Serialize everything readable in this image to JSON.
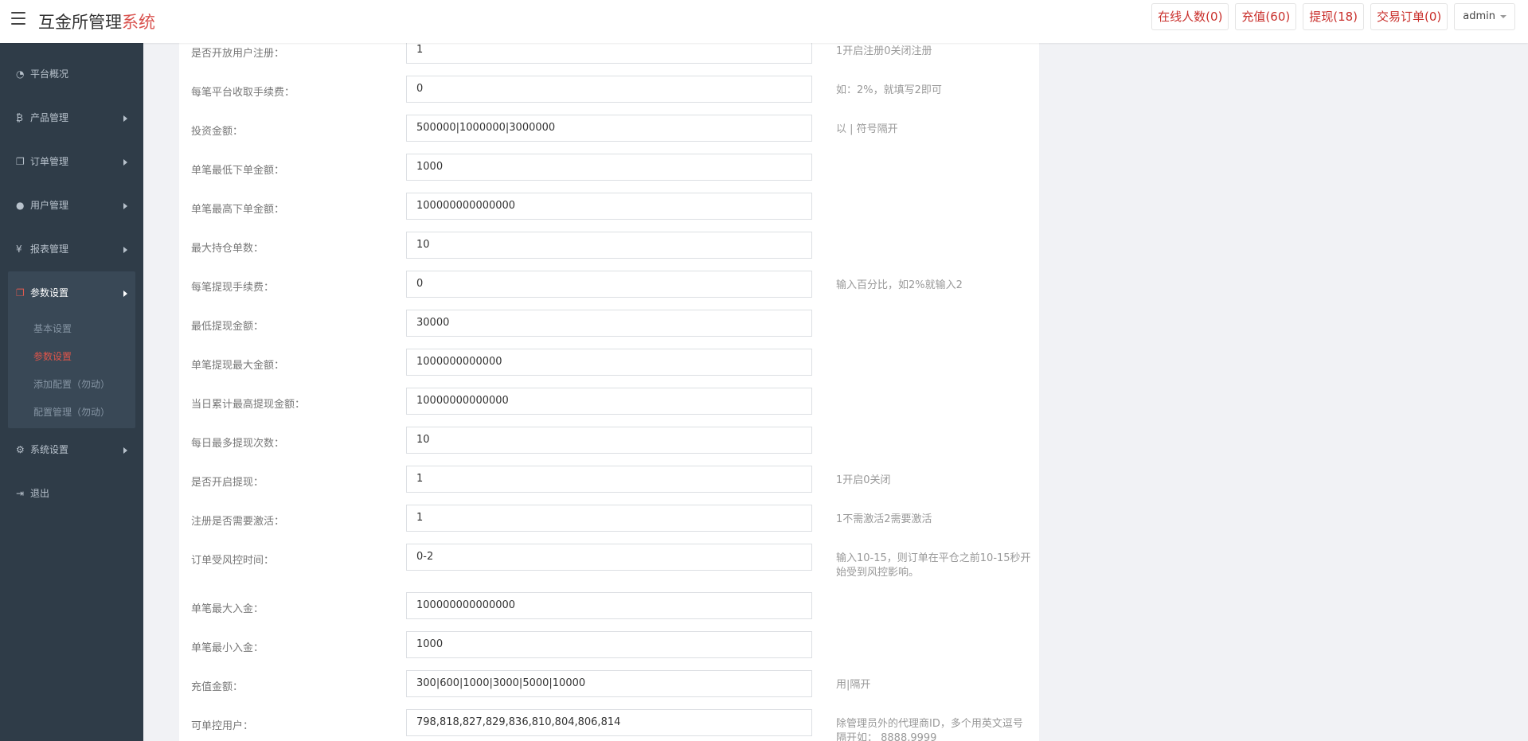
{
  "header": {
    "brand_main": "互金所管理",
    "brand_accent": "系统",
    "online_btn": "在线人数(0)",
    "recharge_btn": "充值(60)",
    "withdraw_btn": "提现(18)",
    "orders_btn": "交易订单(0)",
    "user": "admin"
  },
  "sidebar": {
    "overview": "平台概况",
    "products": "产品管理",
    "orders": "订单管理",
    "users": "用户管理",
    "reports": "报表管理",
    "params": "参数设置",
    "sub_basic": "基本设置",
    "sub_params": "参数设置",
    "sub_add": "添加配置（勿动）",
    "sub_manage": "配置管理（勿动）",
    "system": "系统设置",
    "logout": "退出"
  },
  "form": [
    {
      "label": "是否开放用户注册：",
      "value": "1",
      "hint": "1开启注册0关闭注册"
    },
    {
      "label": "每笔平台收取手续费：",
      "value": "0",
      "hint": "如：2%，就填写2即可"
    },
    {
      "label": "投资金额：",
      "value": "500000|1000000|3000000",
      "hint": "以 | 符号隔开"
    },
    {
      "label": "单笔最低下单金额：",
      "value": "1000",
      "hint": ""
    },
    {
      "label": "单笔最高下单金额：",
      "value": "100000000000000",
      "hint": ""
    },
    {
      "label": "最大持仓单数：",
      "value": "10",
      "hint": ""
    },
    {
      "label": "每笔提现手续费：",
      "value": "0",
      "hint": "输入百分比，如2%就输入2"
    },
    {
      "label": "最低提现金额：",
      "value": "30000",
      "hint": ""
    },
    {
      "label": "单笔提现最大金额：",
      "value": "1000000000000",
      "hint": ""
    },
    {
      "label": "当日累计最高提现金额：",
      "value": "10000000000000",
      "hint": ""
    },
    {
      "label": "每日最多提现次数：",
      "value": "10",
      "hint": ""
    },
    {
      "label": "是否开启提现：",
      "value": "1",
      "hint": "1开启0关闭"
    },
    {
      "label": "注册是否需要激活：",
      "value": "1",
      "hint": "1不需激活2需要激活"
    },
    {
      "label": "订单受风控时间：",
      "value": "0-2",
      "hint": "输入10-15，则订单在平仓之前10-15秒开始受到风控影响。"
    },
    {
      "label": "单笔最大入金：",
      "value": "100000000000000",
      "hint": ""
    },
    {
      "label": "单笔最小入金：",
      "value": "1000",
      "hint": ""
    },
    {
      "label": "充值金额：",
      "value": "300|600|1000|3000|5000|10000",
      "hint": "用|隔开"
    },
    {
      "label": "可单控用户：",
      "value": "798,818,827,829,836,810,804,806,814",
      "hint": "除管理员外的代理商ID，多个用英文逗号隔开如：  8888,9999"
    }
  ]
}
